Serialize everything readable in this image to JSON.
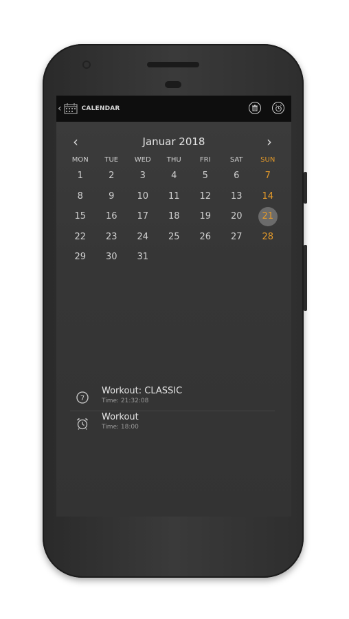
{
  "app": {
    "title": "CALENDAR"
  },
  "calendar": {
    "month_label": "Januar 2018",
    "weekdays": [
      "MON",
      "TUE",
      "WED",
      "THU",
      "FRI",
      "SAT",
      "SUN"
    ],
    "weeks": [
      [
        "1",
        "2",
        "3",
        "4",
        "5",
        "6",
        "7"
      ],
      [
        "8",
        "9",
        "10",
        "11",
        "12",
        "13",
        "14"
      ],
      [
        "15",
        "16",
        "17",
        "18",
        "19",
        "20",
        "21"
      ],
      [
        "22",
        "23",
        "24",
        "25",
        "26",
        "27",
        "28"
      ],
      [
        "29",
        "30",
        "31",
        "",
        "",
        "",
        ""
      ]
    ],
    "selected_day": "21",
    "accent_color": "#e49a2a"
  },
  "events": [
    {
      "title": "Workout: CLASSIC",
      "subtitle": "Time: 21:32:08",
      "icon": "stopwatch-icon"
    },
    {
      "title": "Workout",
      "subtitle": "Time: 18:00",
      "icon": "alarm-clock-icon"
    }
  ]
}
